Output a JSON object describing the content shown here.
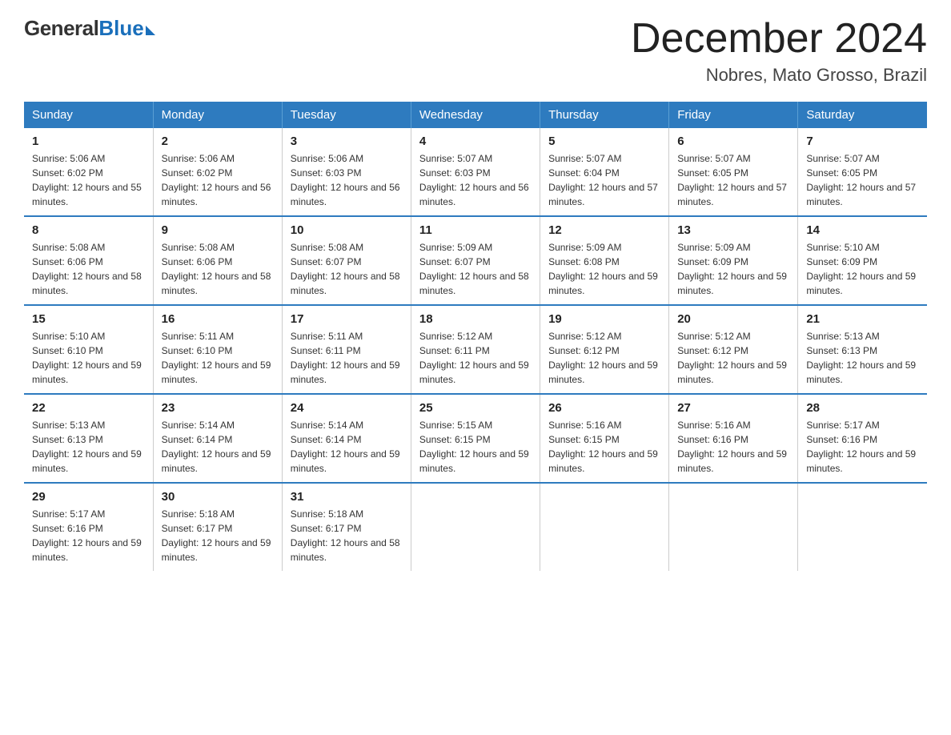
{
  "logo": {
    "general": "General",
    "blue": "Blue"
  },
  "title": {
    "month": "December 2024",
    "location": "Nobres, Mato Grosso, Brazil"
  },
  "days_of_week": [
    "Sunday",
    "Monday",
    "Tuesday",
    "Wednesday",
    "Thursday",
    "Friday",
    "Saturday"
  ],
  "weeks": [
    [
      {
        "day": "1",
        "sunrise": "Sunrise: 5:06 AM",
        "sunset": "Sunset: 6:02 PM",
        "daylight": "Daylight: 12 hours and 55 minutes."
      },
      {
        "day": "2",
        "sunrise": "Sunrise: 5:06 AM",
        "sunset": "Sunset: 6:02 PM",
        "daylight": "Daylight: 12 hours and 56 minutes."
      },
      {
        "day": "3",
        "sunrise": "Sunrise: 5:06 AM",
        "sunset": "Sunset: 6:03 PM",
        "daylight": "Daylight: 12 hours and 56 minutes."
      },
      {
        "day": "4",
        "sunrise": "Sunrise: 5:07 AM",
        "sunset": "Sunset: 6:03 PM",
        "daylight": "Daylight: 12 hours and 56 minutes."
      },
      {
        "day": "5",
        "sunrise": "Sunrise: 5:07 AM",
        "sunset": "Sunset: 6:04 PM",
        "daylight": "Daylight: 12 hours and 57 minutes."
      },
      {
        "day": "6",
        "sunrise": "Sunrise: 5:07 AM",
        "sunset": "Sunset: 6:05 PM",
        "daylight": "Daylight: 12 hours and 57 minutes."
      },
      {
        "day": "7",
        "sunrise": "Sunrise: 5:07 AM",
        "sunset": "Sunset: 6:05 PM",
        "daylight": "Daylight: 12 hours and 57 minutes."
      }
    ],
    [
      {
        "day": "8",
        "sunrise": "Sunrise: 5:08 AM",
        "sunset": "Sunset: 6:06 PM",
        "daylight": "Daylight: 12 hours and 58 minutes."
      },
      {
        "day": "9",
        "sunrise": "Sunrise: 5:08 AM",
        "sunset": "Sunset: 6:06 PM",
        "daylight": "Daylight: 12 hours and 58 minutes."
      },
      {
        "day": "10",
        "sunrise": "Sunrise: 5:08 AM",
        "sunset": "Sunset: 6:07 PM",
        "daylight": "Daylight: 12 hours and 58 minutes."
      },
      {
        "day": "11",
        "sunrise": "Sunrise: 5:09 AM",
        "sunset": "Sunset: 6:07 PM",
        "daylight": "Daylight: 12 hours and 58 minutes."
      },
      {
        "day": "12",
        "sunrise": "Sunrise: 5:09 AM",
        "sunset": "Sunset: 6:08 PM",
        "daylight": "Daylight: 12 hours and 59 minutes."
      },
      {
        "day": "13",
        "sunrise": "Sunrise: 5:09 AM",
        "sunset": "Sunset: 6:09 PM",
        "daylight": "Daylight: 12 hours and 59 minutes."
      },
      {
        "day": "14",
        "sunrise": "Sunrise: 5:10 AM",
        "sunset": "Sunset: 6:09 PM",
        "daylight": "Daylight: 12 hours and 59 minutes."
      }
    ],
    [
      {
        "day": "15",
        "sunrise": "Sunrise: 5:10 AM",
        "sunset": "Sunset: 6:10 PM",
        "daylight": "Daylight: 12 hours and 59 minutes."
      },
      {
        "day": "16",
        "sunrise": "Sunrise: 5:11 AM",
        "sunset": "Sunset: 6:10 PM",
        "daylight": "Daylight: 12 hours and 59 minutes."
      },
      {
        "day": "17",
        "sunrise": "Sunrise: 5:11 AM",
        "sunset": "Sunset: 6:11 PM",
        "daylight": "Daylight: 12 hours and 59 minutes."
      },
      {
        "day": "18",
        "sunrise": "Sunrise: 5:12 AM",
        "sunset": "Sunset: 6:11 PM",
        "daylight": "Daylight: 12 hours and 59 minutes."
      },
      {
        "day": "19",
        "sunrise": "Sunrise: 5:12 AM",
        "sunset": "Sunset: 6:12 PM",
        "daylight": "Daylight: 12 hours and 59 minutes."
      },
      {
        "day": "20",
        "sunrise": "Sunrise: 5:12 AM",
        "sunset": "Sunset: 6:12 PM",
        "daylight": "Daylight: 12 hours and 59 minutes."
      },
      {
        "day": "21",
        "sunrise": "Sunrise: 5:13 AM",
        "sunset": "Sunset: 6:13 PM",
        "daylight": "Daylight: 12 hours and 59 minutes."
      }
    ],
    [
      {
        "day": "22",
        "sunrise": "Sunrise: 5:13 AM",
        "sunset": "Sunset: 6:13 PM",
        "daylight": "Daylight: 12 hours and 59 minutes."
      },
      {
        "day": "23",
        "sunrise": "Sunrise: 5:14 AM",
        "sunset": "Sunset: 6:14 PM",
        "daylight": "Daylight: 12 hours and 59 minutes."
      },
      {
        "day": "24",
        "sunrise": "Sunrise: 5:14 AM",
        "sunset": "Sunset: 6:14 PM",
        "daylight": "Daylight: 12 hours and 59 minutes."
      },
      {
        "day": "25",
        "sunrise": "Sunrise: 5:15 AM",
        "sunset": "Sunset: 6:15 PM",
        "daylight": "Daylight: 12 hours and 59 minutes."
      },
      {
        "day": "26",
        "sunrise": "Sunrise: 5:16 AM",
        "sunset": "Sunset: 6:15 PM",
        "daylight": "Daylight: 12 hours and 59 minutes."
      },
      {
        "day": "27",
        "sunrise": "Sunrise: 5:16 AM",
        "sunset": "Sunset: 6:16 PM",
        "daylight": "Daylight: 12 hours and 59 minutes."
      },
      {
        "day": "28",
        "sunrise": "Sunrise: 5:17 AM",
        "sunset": "Sunset: 6:16 PM",
        "daylight": "Daylight: 12 hours and 59 minutes."
      }
    ],
    [
      {
        "day": "29",
        "sunrise": "Sunrise: 5:17 AM",
        "sunset": "Sunset: 6:16 PM",
        "daylight": "Daylight: 12 hours and 59 minutes."
      },
      {
        "day": "30",
        "sunrise": "Sunrise: 5:18 AM",
        "sunset": "Sunset: 6:17 PM",
        "daylight": "Daylight: 12 hours and 59 minutes."
      },
      {
        "day": "31",
        "sunrise": "Sunrise: 5:18 AM",
        "sunset": "Sunset: 6:17 PM",
        "daylight": "Daylight: 12 hours and 58 minutes."
      },
      null,
      null,
      null,
      null
    ]
  ]
}
